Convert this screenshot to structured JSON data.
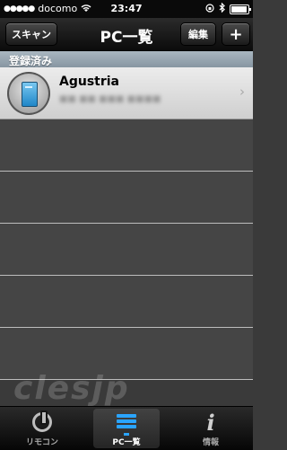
{
  "status_bar": {
    "carrier": "docomo",
    "signal_dots": "●●●●●",
    "time": "23:47"
  },
  "navbar": {
    "scan_label": "スキャン",
    "title": "PC一覧",
    "edit_label": "編集",
    "add_label": "+"
  },
  "section": {
    "header": "登録済み"
  },
  "pcs": [
    {
      "name": "Agustria",
      "detail": "■■ ■■ ■■■ ■■■■"
    }
  ],
  "tabs": [
    {
      "label": "リモコン",
      "icon": "power-icon",
      "active": false
    },
    {
      "label": "PC一覧",
      "icon": "pc-list-icon",
      "active": true
    },
    {
      "label": "情報",
      "icon": "info-icon",
      "active": false
    }
  ],
  "watermark": "clesjp",
  "colors": {
    "accent": "#2aa4ff",
    "section_header": "#9aa8b4",
    "row_bg": "#e5e5e5",
    "empty_row_bg": "#454545"
  }
}
